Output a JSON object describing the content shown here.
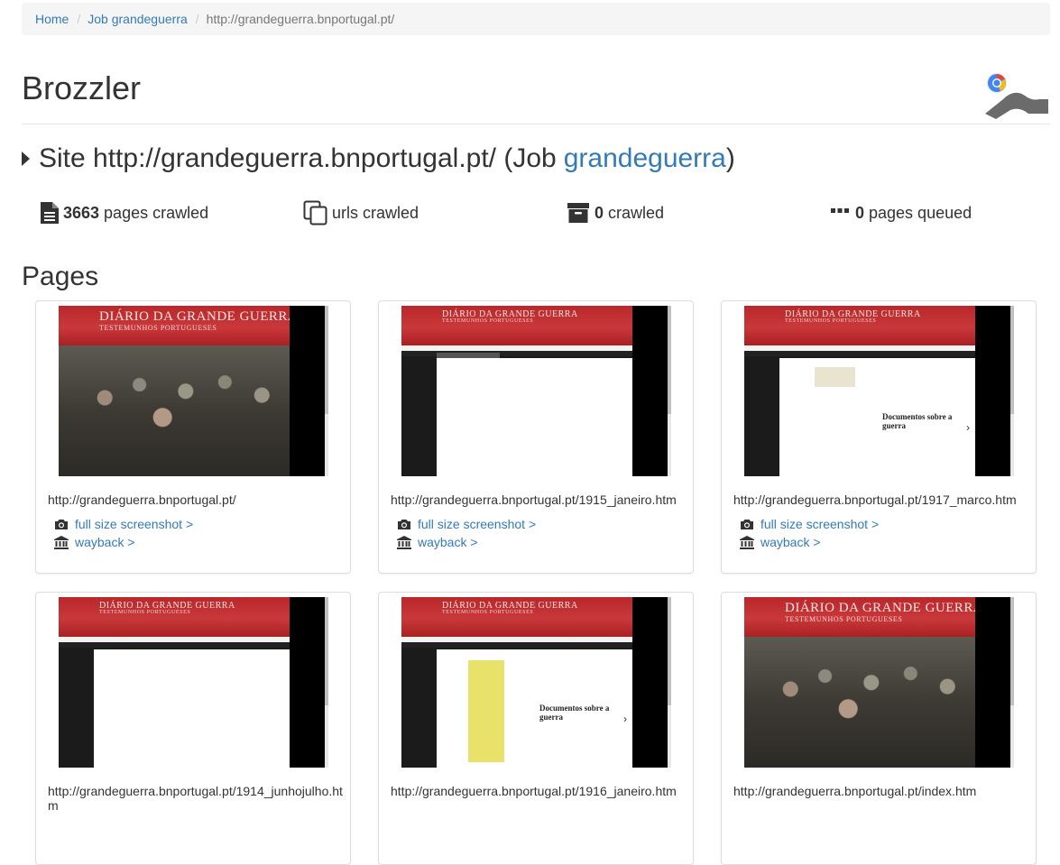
{
  "breadcrumb": {
    "home": "Home",
    "job": "Job grandeguerra",
    "current": "http://grandeguerra.bnportugal.pt/"
  },
  "header": {
    "title": "Brozzler"
  },
  "site": {
    "prefix": "Site http://grandeguerra.bnportugal.pt/ (Job",
    "job_link": "grandeguerra",
    "suffix": ")"
  },
  "stats": {
    "pages_crawled": {
      "count": "3663",
      "label": "pages crawled"
    },
    "urls_crawled": {
      "label": "urls crawled"
    },
    "crawled": {
      "count": "0",
      "label": "crawled"
    },
    "pages_queued": {
      "count": "0",
      "label": "pages queued"
    }
  },
  "pages_heading": "Pages",
  "links": {
    "screenshot": "full size screenshot >",
    "wayback": "wayback >"
  },
  "thumbnail_text": {
    "banner_title": "DIÁRIO DA GRANDE GUERRA",
    "banner_subtitle": "TESTEMUNHOS PORTUGUESES",
    "doc_title": "Documentos sobre a guerra"
  },
  "pages": [
    {
      "url": "http://grandeguerra.bnportugal.pt/"
    },
    {
      "url": "http://grandeguerra.bnportugal.pt/1915_janeiro.htm"
    },
    {
      "url": "http://grandeguerra.bnportugal.pt/1917_marco.htm"
    },
    {
      "url": "http://grandeguerra.bnportugal.pt/1914_junhojulho.htm"
    },
    {
      "url": "http://grandeguerra.bnportugal.pt/1916_janeiro.htm"
    },
    {
      "url": "http://grandeguerra.bnportugal.pt/index.htm"
    }
  ],
  "colors": {
    "link": "#337ab7",
    "text": "#333333",
    "banner": "#c0302f"
  }
}
